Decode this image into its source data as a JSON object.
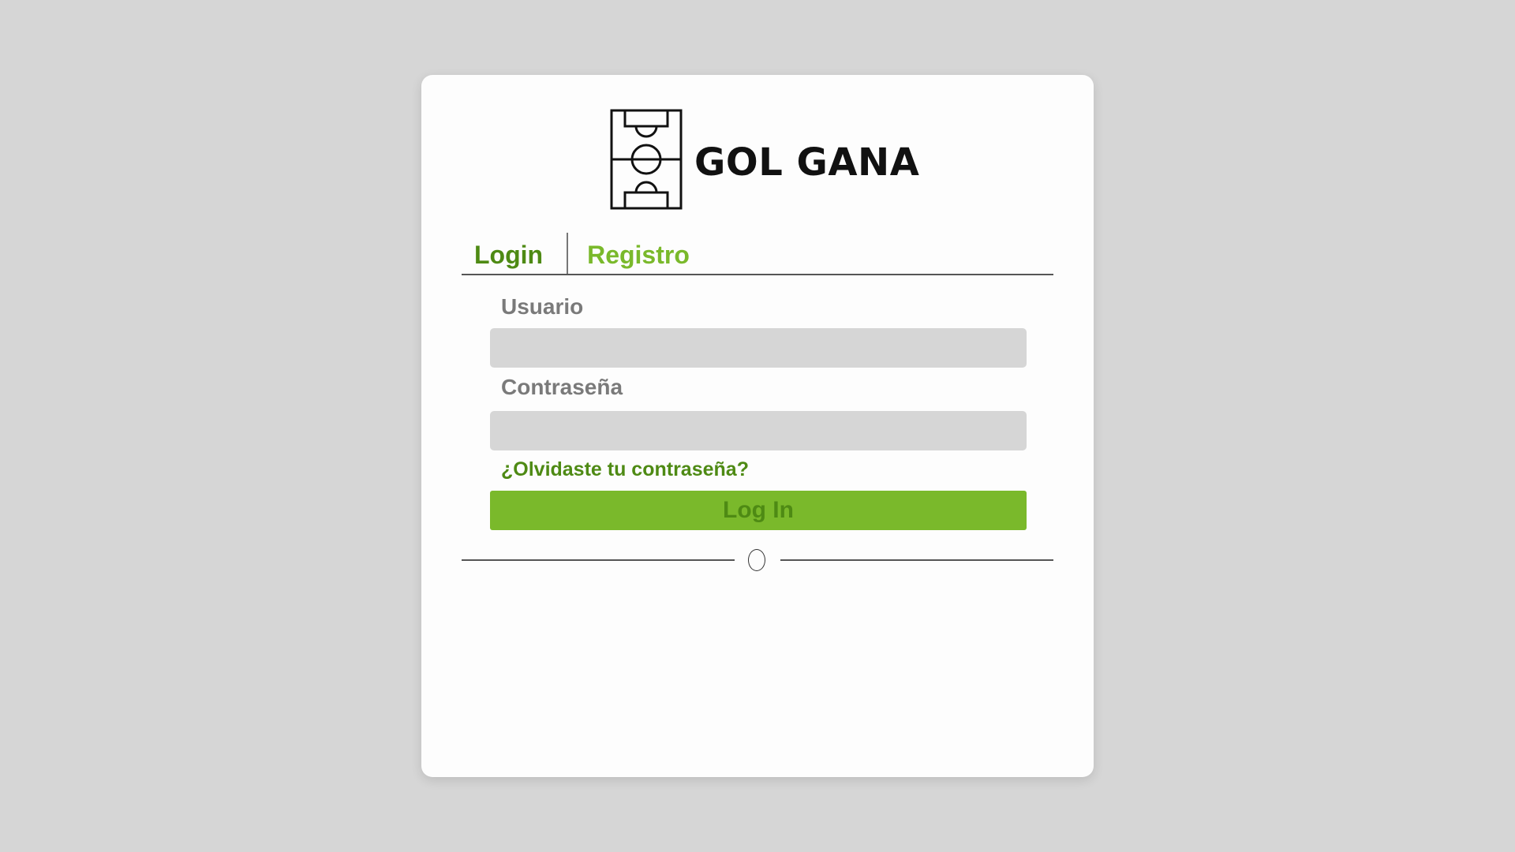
{
  "brand": {
    "name": "GOL GANA",
    "icon": "soccer-field-icon"
  },
  "tabs": [
    {
      "label": "Login",
      "active": true
    },
    {
      "label": "Registro",
      "active": false
    }
  ],
  "form": {
    "username_label": "Usuario",
    "username_value": "",
    "password_label": "Contraseña",
    "password_value": "",
    "forgot_link": "¿Olvidaste tu contraseña?",
    "submit_label": "Log In"
  },
  "divider": {
    "icon": "circle-icon"
  },
  "colors": {
    "background": "#d6d6d6",
    "card": "#fdfdfd",
    "accent_dark": "#4e8a14",
    "accent_light": "#7ab92b",
    "label_gray": "#7a7a7a",
    "input_bg": "#d6d6d6"
  }
}
